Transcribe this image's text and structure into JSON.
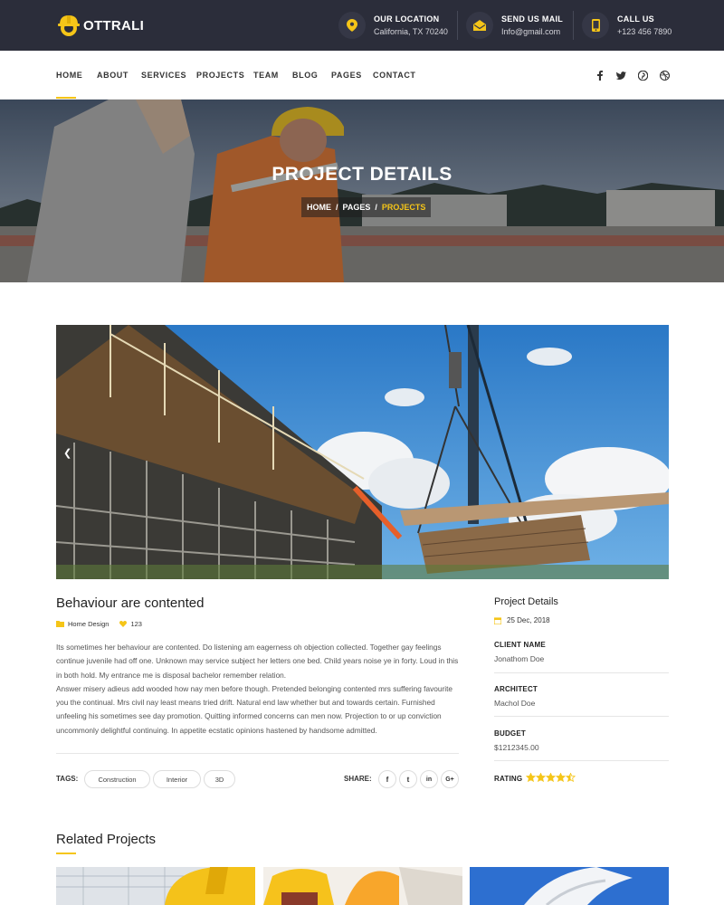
{
  "brand": {
    "name": "OTTRALI",
    "accent": "#f5c518",
    "topbar_bg": "#2b2d3a"
  },
  "contacts": [
    {
      "icon": "map-pin-icon",
      "label": "OUR LOCATION",
      "value": "California, TX 70240"
    },
    {
      "icon": "envelope-icon",
      "label": "SEND US MAIL",
      "value": "Info@gmail.com"
    },
    {
      "icon": "mobile-phone-icon",
      "label": "CALL US",
      "value": "+123 456 7890"
    }
  ],
  "nav": {
    "items": [
      "HOME",
      "ABOUT",
      "SERVICES",
      "PROJECTS",
      "TEAM",
      "BLOG",
      "PAGES",
      "CONTACT"
    ],
    "active": "HOME",
    "social_icons": [
      "facebook-icon",
      "twitter-icon",
      "pinterest-icon",
      "dribbble-icon"
    ]
  },
  "hero": {
    "title": "PROJECT DETAILS",
    "breadcrumb": [
      "HOME",
      "PAGES",
      "PROJECTS"
    ],
    "separator": "/"
  },
  "article": {
    "title": "Behaviour are contented",
    "category": "Home Design",
    "likes": "123",
    "paragraphs": [
      "Its sometimes her behaviour are contented. Do listening am eagerness oh objection collected. Together gay feelings continue juvenile had off one. Unknown may service subject her letters one bed. Child years noise ye in forty. Loud in this in both hold. My entrance me is disposal bachelor remember relation.",
      "Answer misery adieus add wooded how nay men before though. Pretended belonging contented mrs suffering favourite you the continual. Mrs civil nay least means tried drift. Natural end law whether but and towards certain. Furnished unfeeling his sometimes see day promotion. Quitting informed concerns can men now. Projection to or up conviction uncommonly delightful continuing. In appetite ecstatic opinions hastened by handsome admitted."
    ],
    "tags_label": "TAGS:",
    "tags": [
      "Construction",
      "Interior",
      "3D"
    ],
    "share_label": "SHARE:",
    "share_icons": [
      "f",
      "t",
      "in",
      "G+"
    ]
  },
  "sidebar": {
    "title": "Project Details",
    "date": "25 Dec, 2018",
    "client_label": "CLIENT NAME",
    "client_value": "Jonathom Doe",
    "architect_label": "ARCHITECT",
    "architect_value": "Machol Doe",
    "budget_label": "BUDGET",
    "budget_value": "$1212345.00",
    "rating_label": "RATING",
    "rating": 4.5,
    "rating_max": 5
  },
  "related": {
    "title": "Related Projects"
  }
}
